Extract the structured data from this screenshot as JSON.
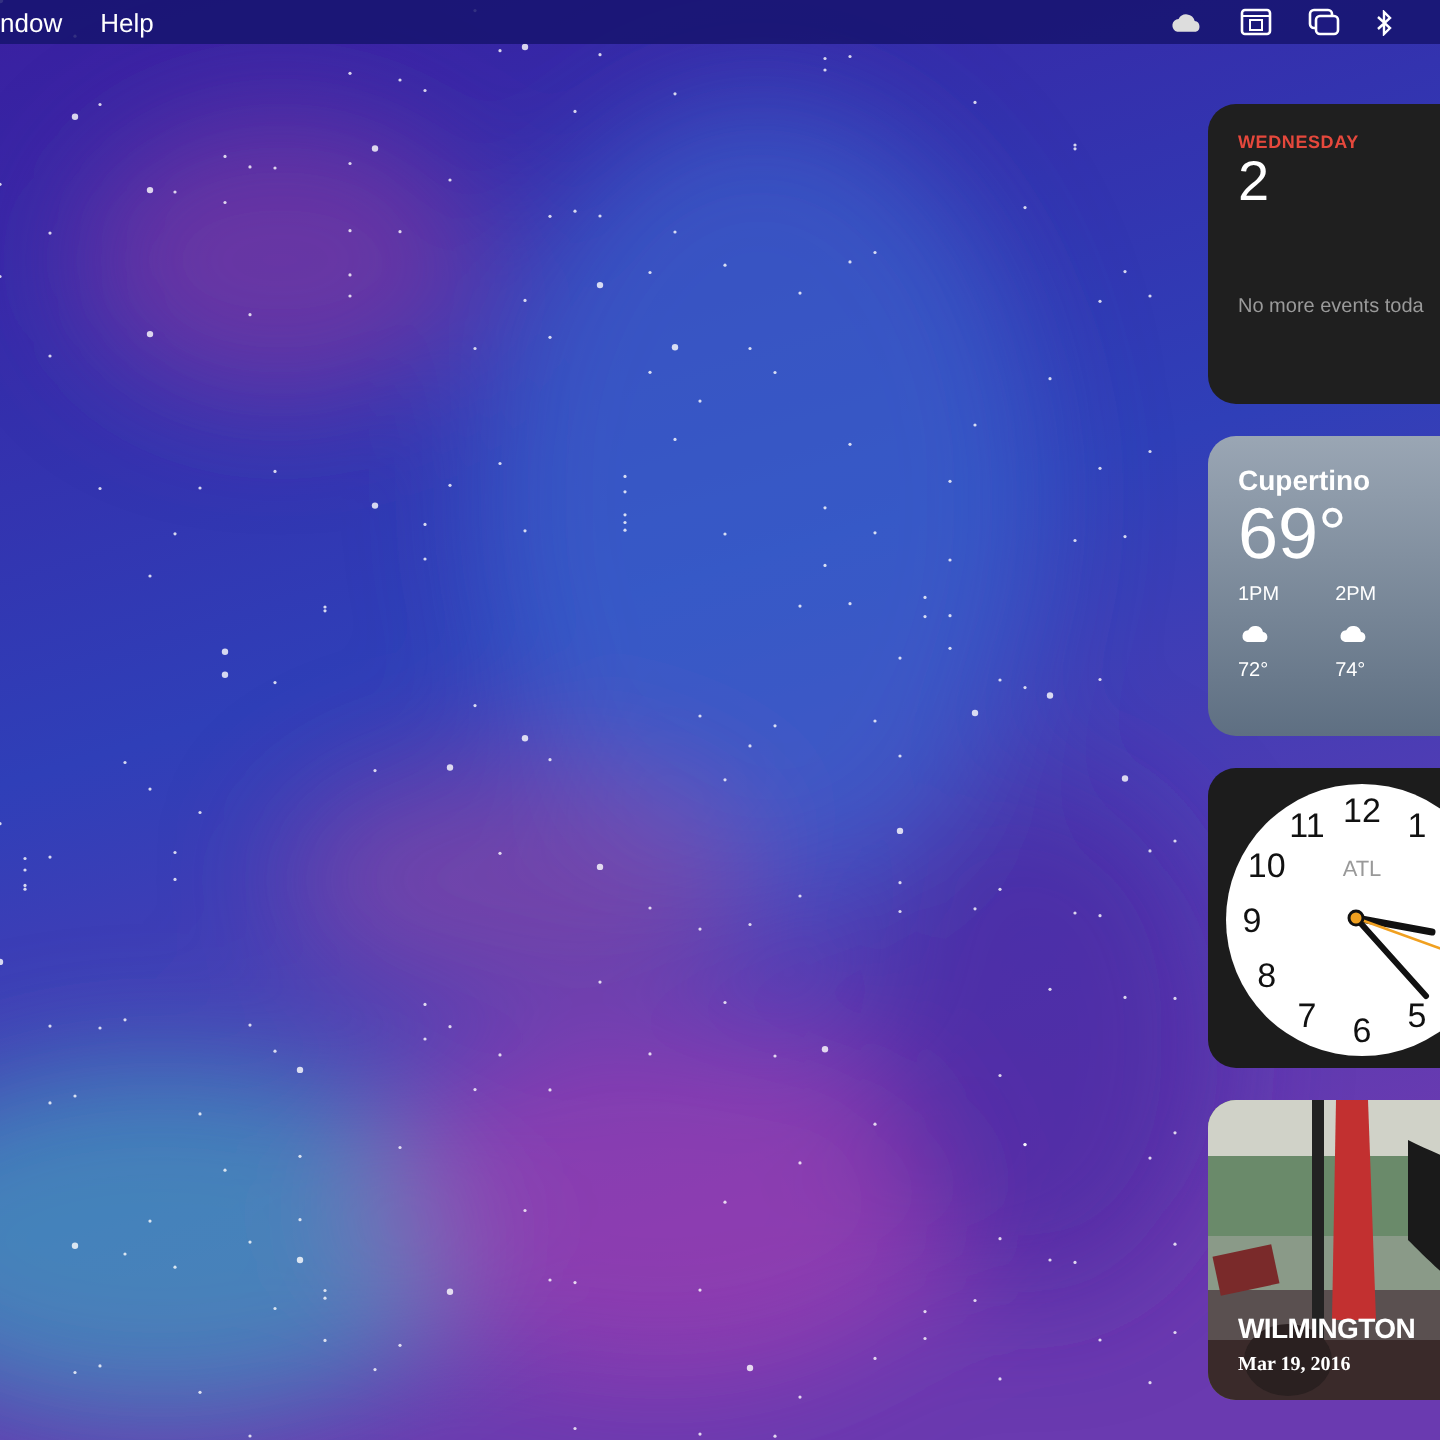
{
  "menu_bar": {
    "menus": [
      "ndow",
      "Help"
    ]
  },
  "calendar_widget": {
    "weekday": "WEDNESDAY",
    "day": "2",
    "note": "No more events toda"
  },
  "weather_widget": {
    "city": "Cupertino",
    "temperature": "69°",
    "forecast": [
      {
        "hour": "1PM",
        "temperature": "72°"
      },
      {
        "hour": "2PM",
        "temperature": "74°"
      }
    ]
  },
  "clock_widget": {
    "city": "ATL",
    "numbers": [
      "11",
      "12",
      "1",
      "10",
      "9",
      "8",
      "7",
      "6",
      "5"
    ]
  },
  "photo_widget": {
    "kind": "picture",
    "place": "WILMINGTON",
    "date": "Mar 19, 2016"
  }
}
